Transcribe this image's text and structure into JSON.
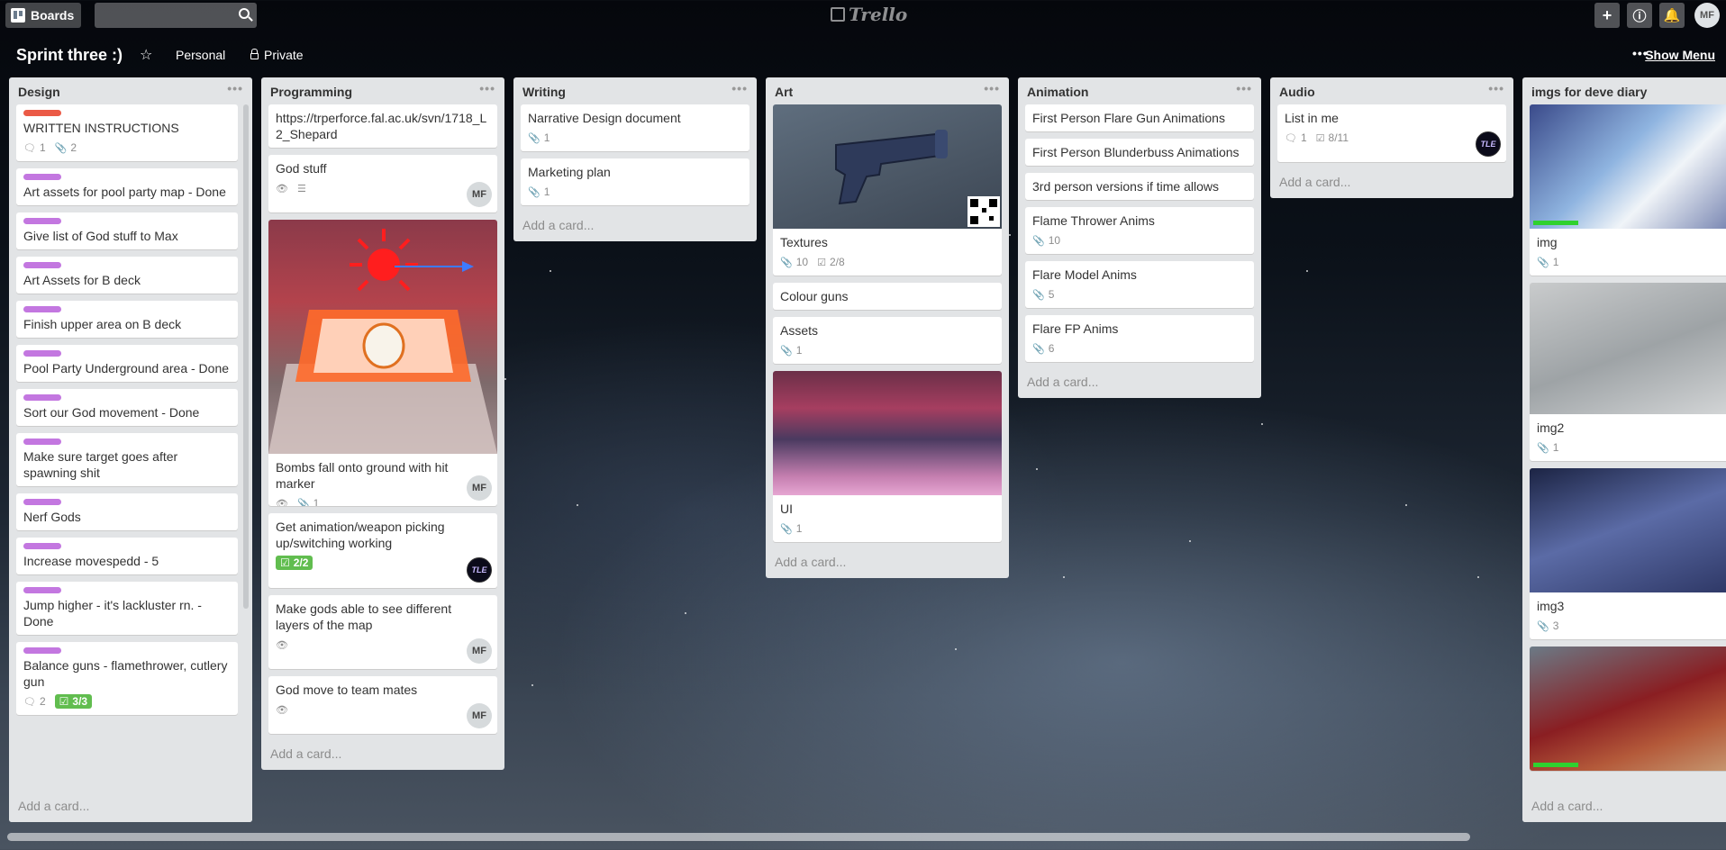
{
  "header": {
    "boards_label": "Boards",
    "logo_text": "Trello",
    "avatar_initials": "MF"
  },
  "board": {
    "title": "Sprint three :)",
    "team": "Personal",
    "visibility": "Private",
    "show_menu": "Show Menu"
  },
  "colors": {
    "label_red": "#eb5a46",
    "label_purple": "#c377e0",
    "check_green": "#61bd4f"
  },
  "lists": {
    "design": {
      "name": "Design",
      "add": "Add a card...",
      "cards": [
        {
          "title": "WRITTEN INSTRUCTIONS",
          "comments": "1",
          "attachments": "2"
        },
        {
          "title": "Art assets for pool party map - Done"
        },
        {
          "title": "Give list of God stuff to Max"
        },
        {
          "title": "Art Assets for B deck"
        },
        {
          "title": "Finish upper area on B deck"
        },
        {
          "title": "Pool Party Underground area - Done"
        },
        {
          "title": "Sort our God movement - Done"
        },
        {
          "title": "Make sure target goes after spawning shit"
        },
        {
          "title": "Nerf Gods"
        },
        {
          "title": "Increase movespedd - 5"
        },
        {
          "title": "Jump higher - it's lackluster rn. - Done"
        },
        {
          "title": "Balance guns - flamethrower, cutlery gun",
          "comments": "2",
          "checklist": "3/3"
        }
      ]
    },
    "programming": {
      "name": "Programming",
      "add": "Add a card...",
      "cards": [
        {
          "title": "https://trperforce.fal.ac.uk/svn/1718_L2_Shepard"
        },
        {
          "title": "God stuff",
          "member": "MF"
        },
        {
          "title": "Bombs fall onto ground with hit marker",
          "attachments": "1",
          "member": "MF"
        },
        {
          "title": "Get animation/weapon picking up/switching working",
          "checklist": "2/2",
          "member": "TLE"
        },
        {
          "title": "Make gods able to see different layers of the map",
          "member": "MF"
        },
        {
          "title": "God move to team mates",
          "member": "MF"
        }
      ]
    },
    "writing": {
      "name": "Writing",
      "add": "Add a card...",
      "cards": [
        {
          "title": "Narrative Design document",
          "attachments": "1"
        },
        {
          "title": "Marketing plan",
          "attachments": "1"
        }
      ]
    },
    "art": {
      "name": "Art",
      "add": "Add a card...",
      "cards": [
        {
          "title": "Textures",
          "attachments": "10",
          "checklist": "2/8"
        },
        {
          "title": "Colour guns"
        },
        {
          "title": "Assets",
          "attachments": "1"
        },
        {
          "title": "UI",
          "attachments": "1"
        }
      ]
    },
    "animation": {
      "name": "Animation",
      "add": "Add a card...",
      "cards": [
        {
          "title": "First Person Flare Gun Animations"
        },
        {
          "title": "First Person Blunderbuss Animations"
        },
        {
          "title": "3rd person versions if time allows"
        },
        {
          "title": "Flame Thrower Anims",
          "attachments": "10"
        },
        {
          "title": "Flare Model Anims",
          "attachments": "5"
        },
        {
          "title": "Flare FP Anims",
          "attachments": "6"
        }
      ]
    },
    "audio": {
      "name": "Audio",
      "add": "Add a card...",
      "cards": [
        {
          "title": "List in me",
          "comments": "1",
          "checklist": "8/11",
          "member": "TLE"
        }
      ]
    },
    "imgs": {
      "name": "imgs for deve diary",
      "add": "Add a card...",
      "cards": [
        {
          "title": "img",
          "attachments": "1"
        },
        {
          "title": "img2",
          "attachments": "1"
        },
        {
          "title": "img3",
          "attachments": "3"
        },
        {
          "title": ""
        }
      ]
    }
  }
}
